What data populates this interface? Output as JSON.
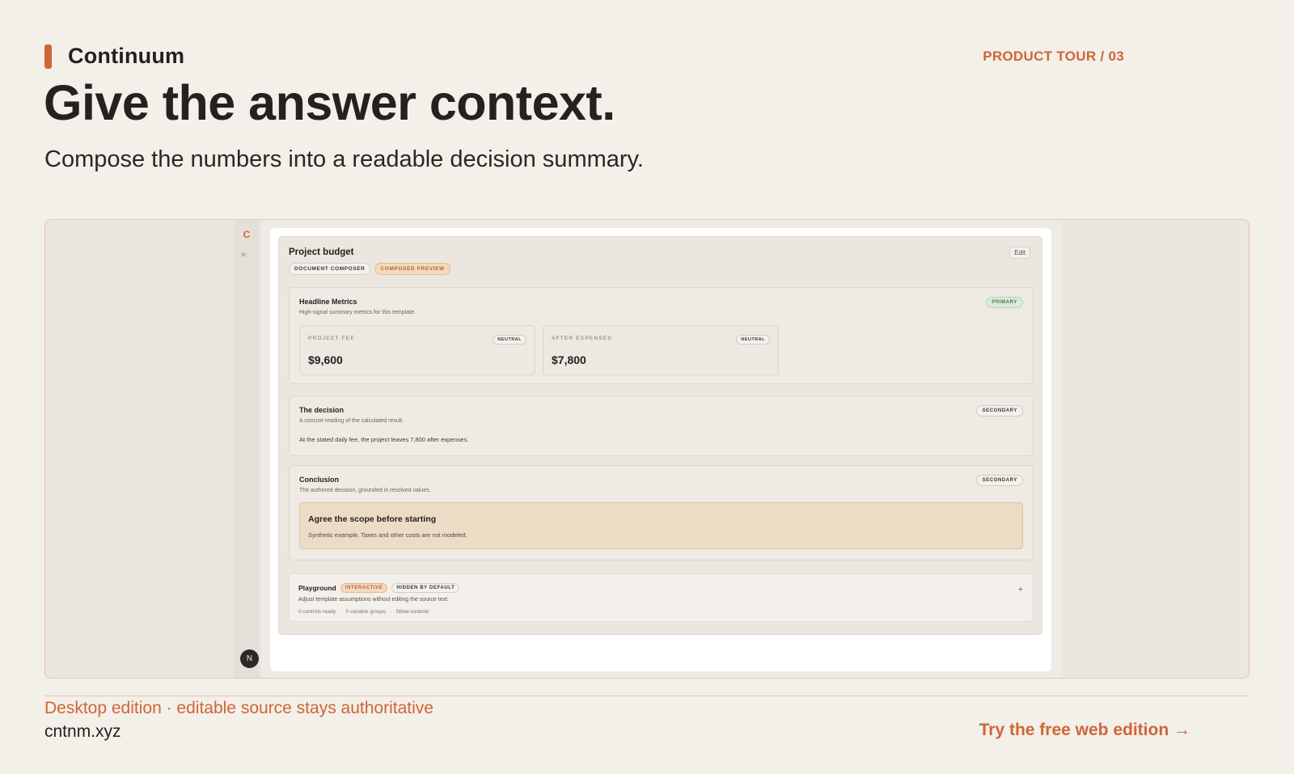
{
  "brand": {
    "name": "Continuum",
    "accent": "#cf6636"
  },
  "tour_label": "PRODUCT TOUR / 03",
  "headline": "Give the answer context.",
  "subhead": "Compose the numbers into a readable decision summary.",
  "app": {
    "rail": {
      "logo": "C",
      "expand": "»",
      "avatar": "N"
    },
    "document": {
      "title": "Project budget",
      "edit_label": "Edit",
      "chips": [
        "DOCUMENT COMPOSER",
        "COMPOSED PREVIEW"
      ],
      "headline_metrics": {
        "title": "Headline Metrics",
        "description": "High-signal summary metrics for this template.",
        "badge": "PRIMARY",
        "metrics": [
          {
            "label": "PROJECT FEE",
            "tag": "NEUTRAL",
            "value": "$9,600"
          },
          {
            "label": "AFTER EXPENSES",
            "tag": "NEUTRAL",
            "value": "$7,800"
          }
        ]
      },
      "decision": {
        "title": "The decision",
        "description": "A concise reading of the calculated result.",
        "badge": "SECONDARY",
        "text": "At the stated daily fee, the project leaves 7,800 after expenses."
      },
      "conclusion": {
        "title": "Conclusion",
        "description": "The authored decision, grounded in resolved values.",
        "badge": "SECONDARY",
        "callout_title": "Agree the scope before starting",
        "callout_text": "Synthetic example. Taxes and other costs are not modeled."
      },
      "playground": {
        "title": "Playground",
        "chips": [
          "INTERACTIVE",
          "HIDDEN BY DEFAULT"
        ],
        "description": "Adjust template assumptions without editing the source text.",
        "meta": [
          "0 controls ready",
          "·",
          "0 variable groups",
          "·",
          "Show controls"
        ],
        "toggle": "+"
      }
    }
  },
  "footer": {
    "note": "Desktop edition · editable source stays authoritative",
    "url": "cntnm.xyz",
    "cta": "Try the free web edition →"
  }
}
